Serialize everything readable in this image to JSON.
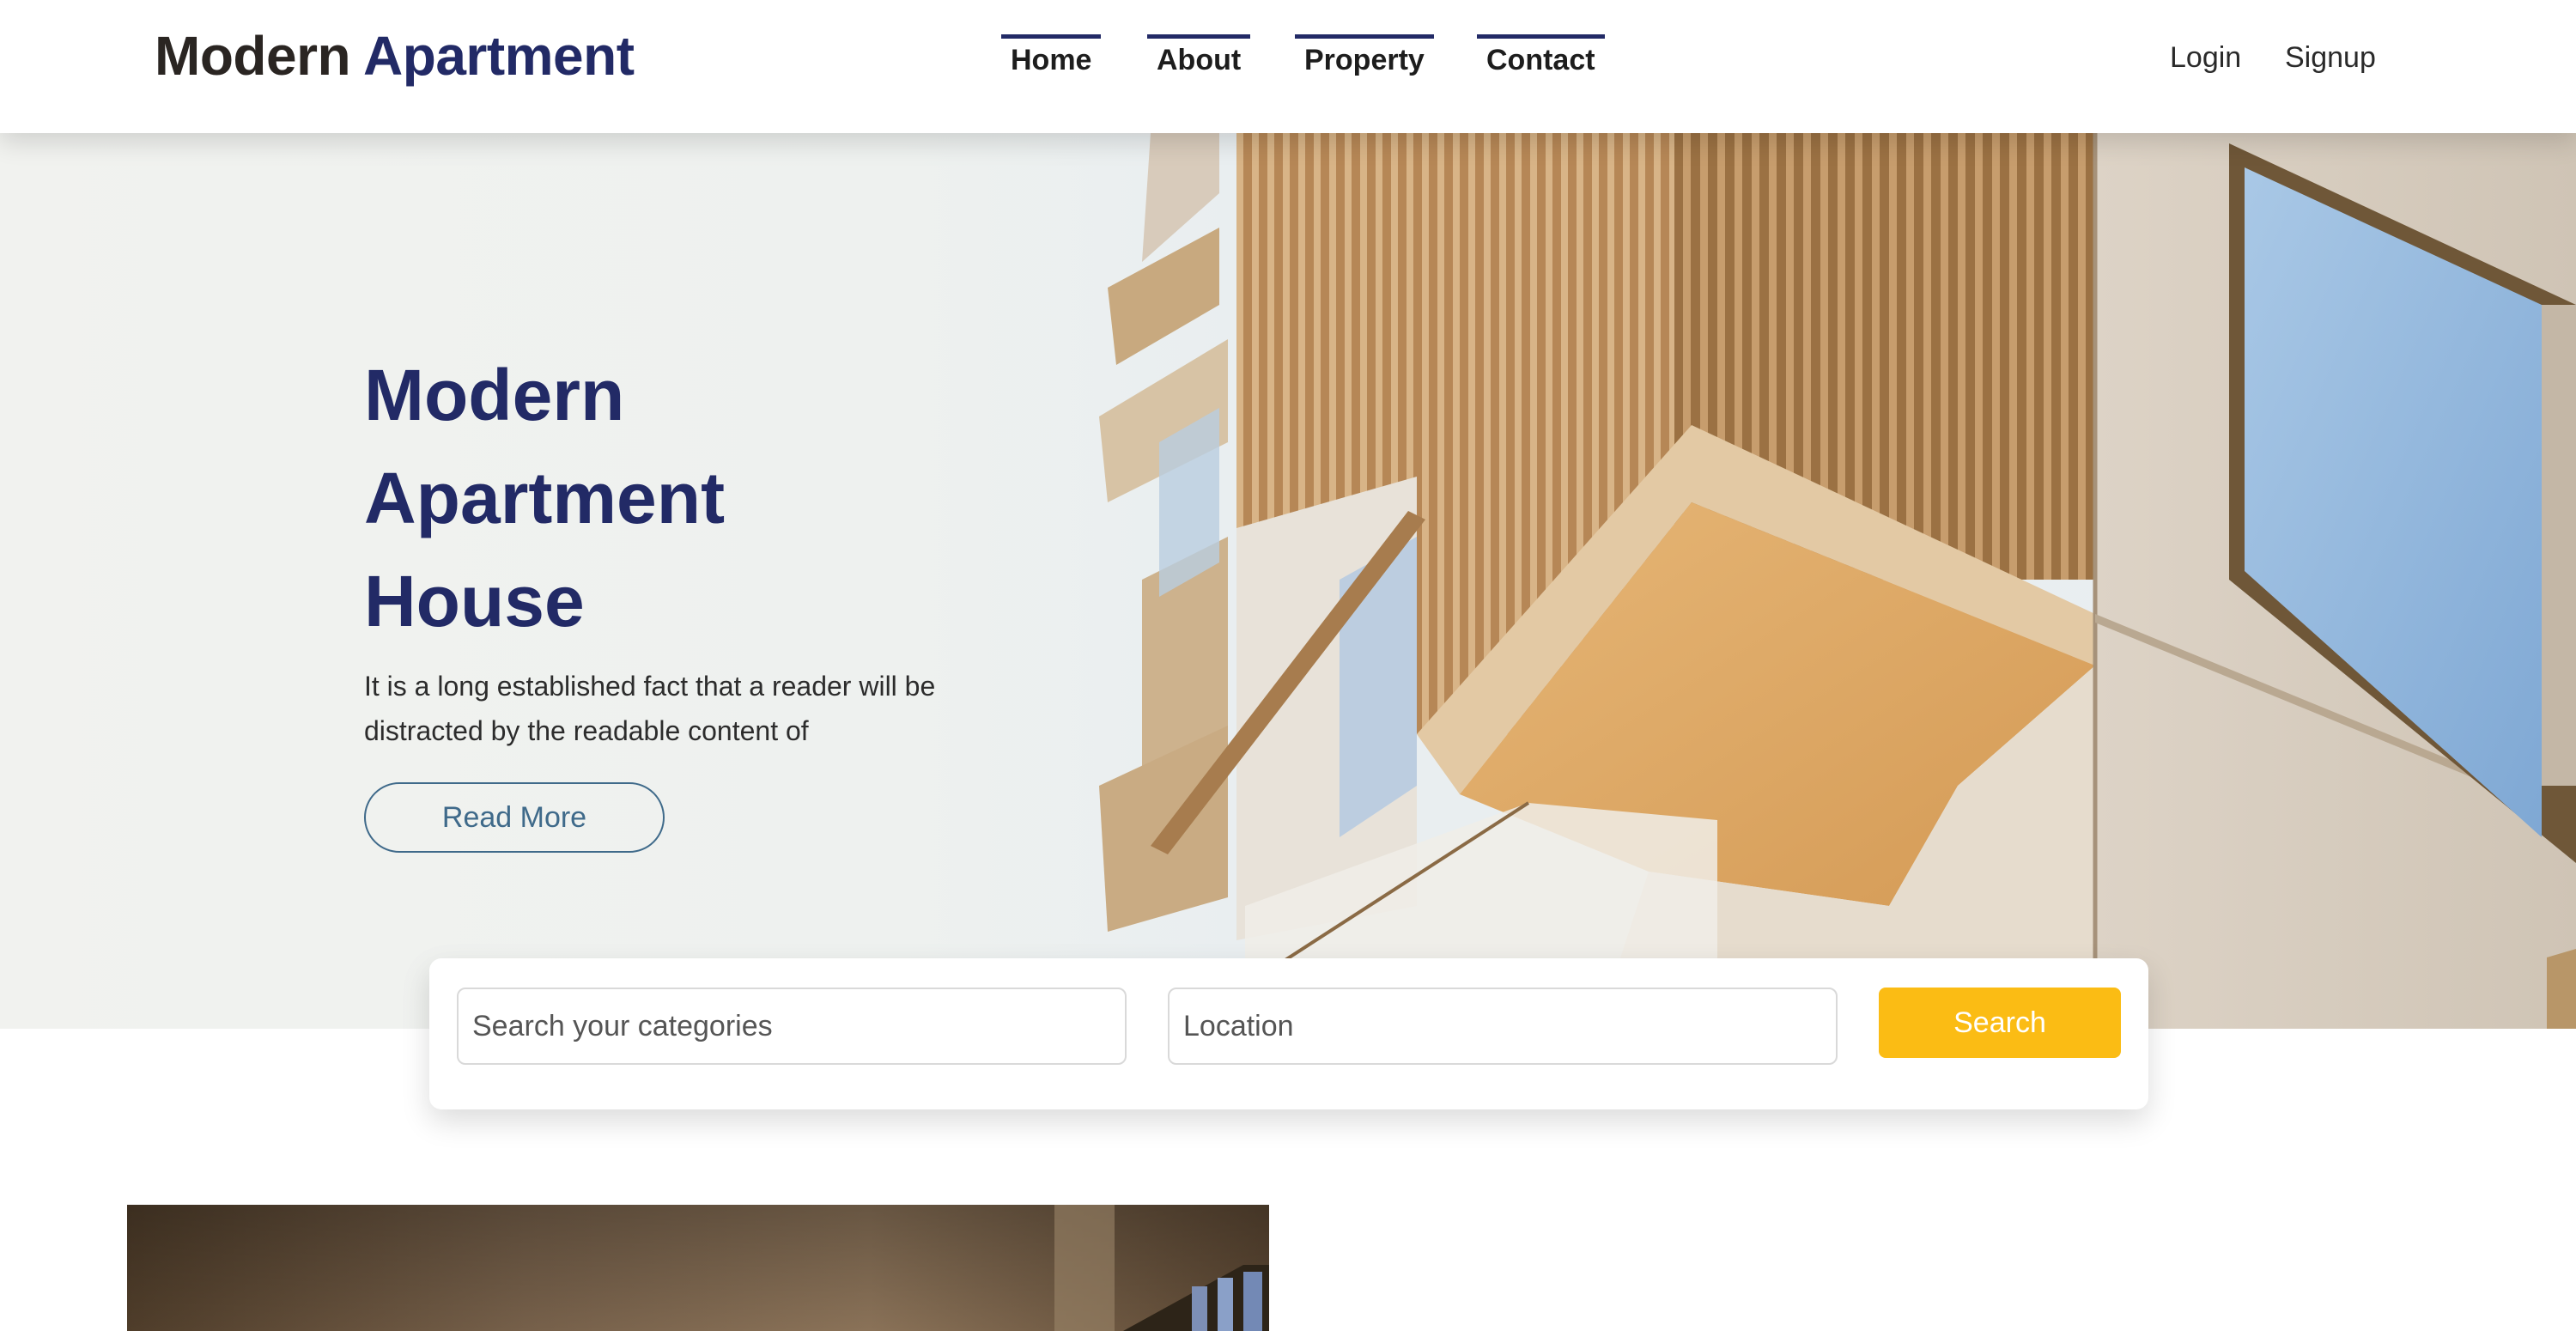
{
  "header": {
    "logo": {
      "word1": "Modern",
      "word2": "Apartment"
    },
    "nav": [
      {
        "label": "Home"
      },
      {
        "label": "About"
      },
      {
        "label": "Property"
      },
      {
        "label": "Contact"
      }
    ],
    "auth": {
      "login": "Login",
      "signup": "Signup"
    }
  },
  "hero": {
    "title_lines": [
      "Modern",
      "Apartment",
      "House"
    ],
    "description": "It is a long established fact that a reader will be distracted by the readable content of",
    "cta_label": "Read More"
  },
  "search": {
    "category_placeholder": "Search your categories",
    "location_placeholder": "Location",
    "button_label": "Search"
  },
  "colors": {
    "brand_navy": "#222a66",
    "accent_yellow": "#fbbc14",
    "outline_blue": "#3f6a8a"
  }
}
